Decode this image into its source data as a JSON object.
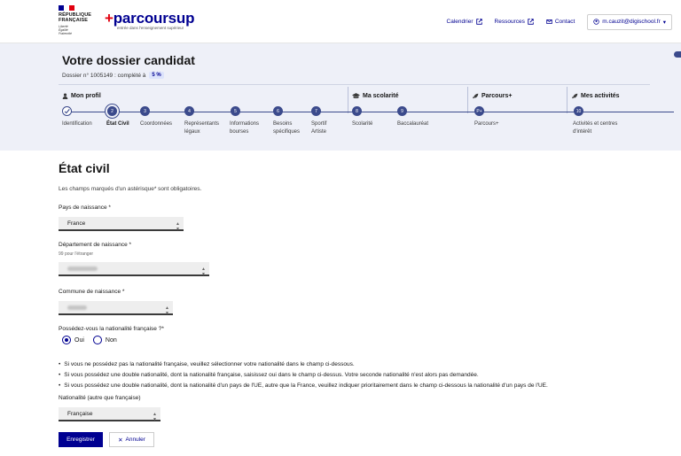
{
  "header": {
    "gov_logo_lines": [
      "RÉPUBLIQUE",
      "FRANÇAISE"
    ],
    "gov_motto": [
      "Liberté",
      "Égalité",
      "Fraternité"
    ],
    "brand": "parcoursup",
    "brand_tagline": "entrée dans l'enseignement supérieur",
    "nav": [
      {
        "label": "Calendrier",
        "icon": "external-link-icon"
      },
      {
        "label": "Ressources",
        "icon": "external-link-icon"
      },
      {
        "label": "Contact",
        "icon": "mail-icon"
      }
    ],
    "user": "m.cauzit@digischool.fr",
    "colors": {
      "primary": "#000091",
      "accent": "#e1000f",
      "band": "#eef0f8"
    }
  },
  "dossier": {
    "title": "Votre dossier candidat",
    "subtitle": "Dossier n° 1005149 : complété à",
    "percent": "5 %",
    "sections": [
      {
        "label": "Mon profil",
        "icon": "person-icon"
      },
      {
        "label": "Ma scolarité",
        "icon": "graduation-cap-icon"
      },
      {
        "label": "Parcours+",
        "icon": "rocket-icon"
      },
      {
        "label": "Mes activités",
        "icon": "rocket-icon"
      }
    ],
    "steps": [
      {
        "num": "",
        "label": "Identification",
        "state": "done"
      },
      {
        "num": "2",
        "label": "État Civil",
        "state": "current"
      },
      {
        "num": "3",
        "label": "Coordonnées",
        "state": "todo"
      },
      {
        "num": "4",
        "label": "Représentants légaux",
        "state": "todo"
      },
      {
        "num": "5",
        "label": "Informations bourses",
        "state": "todo"
      },
      {
        "num": "6",
        "label": "Besoins spécifiques",
        "state": "todo"
      },
      {
        "num": "7",
        "label": "Sportif Artiste",
        "state": "todo"
      },
      {
        "num": "8",
        "label": "Scolarité",
        "state": "todo"
      },
      {
        "num": "9",
        "label": "Baccalauréat",
        "state": "todo"
      },
      {
        "num": "P+",
        "label": "Parcours+",
        "state": "todo"
      },
      {
        "num": "10",
        "label": "Activités et centres d'intérêt",
        "state": "todo"
      }
    ]
  },
  "form": {
    "title": "État civil",
    "required_note": "Les champs marqués d'un astérisque* sont obligatoires.",
    "pays_label": "Pays de naissance",
    "pays_value": "France",
    "dept_label": "Département de naissance",
    "dept_hint": "99 pour l'étranger",
    "commune_label": "Commune de naissance",
    "nationalite_q": "Possédez-vous la nationalité française ?",
    "oui": "Oui",
    "non": "Non",
    "bullets": [
      "Si vous ne possédez pas la nationalité française, veuillez sélectionner votre nationalité dans le champ ci-dessous.",
      "Si vous possédez une double nationalité, dont la nationalité française, saisissez oui dans le champ ci-dessus. Votre seconde nationalité n'est alors pas demandée.",
      "Si vous possédez une double nationalité, dont la nationalité d'un pays de l'UE, autre que la France, veuillez indiquer prioritairement dans le champ ci-dessous la nationalité d'un pays de l'UE."
    ],
    "nationalite_label": "Nationalité (autre que française)",
    "nationalite_value": "Française",
    "save": "Enregistrer",
    "cancel": "Annuler"
  }
}
